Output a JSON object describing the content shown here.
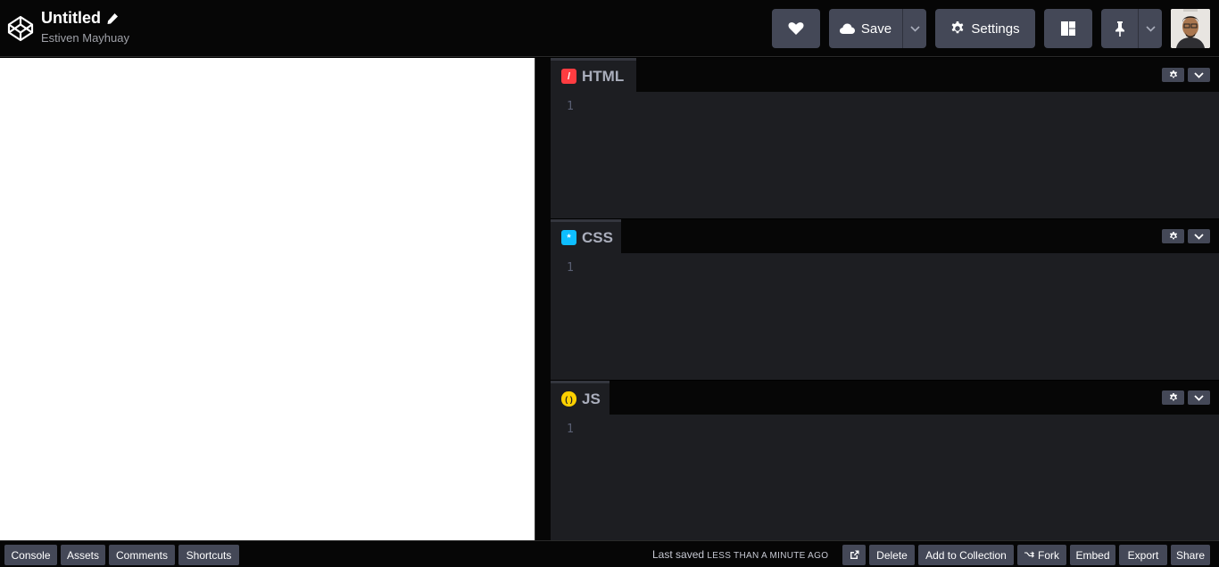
{
  "header": {
    "title": "Untitled",
    "author": "Estiven Mayhuay",
    "save_label": "Save",
    "settings_label": "Settings"
  },
  "editors": [
    {
      "label": "HTML",
      "icon": "html-icon",
      "icon_glyph": "/",
      "color": "#ff3c41",
      "line": "1"
    },
    {
      "label": "CSS",
      "icon": "css-icon",
      "icon_glyph": "*",
      "color": "#0ebeff",
      "line": "1"
    },
    {
      "label": "JS",
      "icon": "js-icon",
      "icon_glyph": "( )",
      "color": "#fcd000",
      "line": "1"
    }
  ],
  "footer": {
    "console": "Console",
    "assets": "Assets",
    "comments": "Comments",
    "shortcuts": "Shortcuts",
    "last_saved": "Last saved",
    "saved_ago": "LESS THAN A MINUTE AGO",
    "delete": "Delete",
    "add_to_collection": "Add to Collection",
    "fork": "Fork",
    "embed": "Embed",
    "export": "Export",
    "share": "Share"
  },
  "colors": {
    "button_bg": "#444857",
    "editor_bg": "#1d1e22",
    "header_bg": "#060606"
  }
}
